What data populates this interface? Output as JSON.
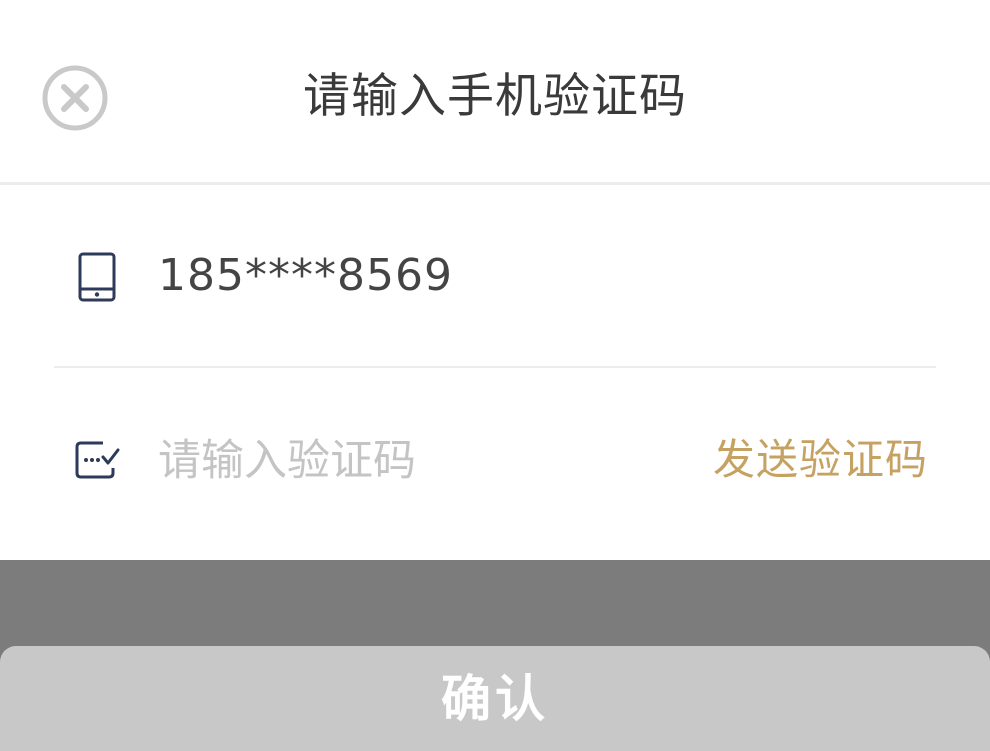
{
  "dialog": {
    "title": "请输入手机验证码",
    "close_icon": "close-circle-icon"
  },
  "phone": {
    "icon": "mobile-phone-icon",
    "number": "185****8569"
  },
  "verification": {
    "icon": "code-message-icon",
    "placeholder": "请输入验证码",
    "value": "",
    "send_code_label": "发送验证码"
  },
  "footer": {
    "confirm_label": "确认"
  },
  "colors": {
    "accent": "#c6a262",
    "title_text": "#3a3a3a",
    "icon_navy": "#2e3a59",
    "placeholder": "#c4c4c4",
    "divider": "#ececec",
    "overlay": "#7c7c7c",
    "confirm_bg": "#c8c8c8"
  }
}
